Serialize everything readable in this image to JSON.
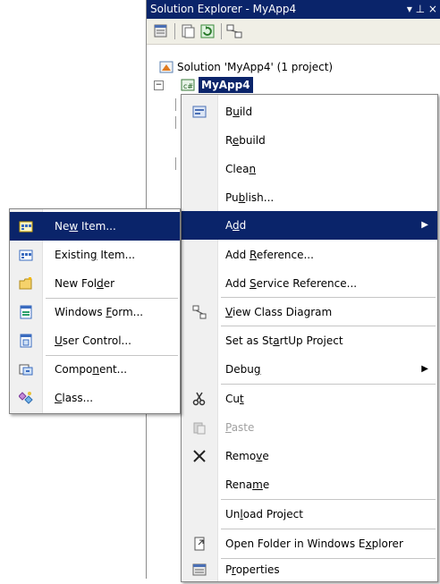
{
  "panel": {
    "title": "Solution Explorer - MyApp4",
    "title_buttons": "▾ ⊥ ×"
  },
  "tree": {
    "solution": "Solution 'MyApp4' (1 project)",
    "project": "MyApp4"
  },
  "context_menu": {
    "items": [
      {
        "pre": "B",
        "u": "u",
        "post": "ild"
      },
      {
        "pre": "R",
        "u": "e",
        "post": "build"
      },
      {
        "pre": "Clea",
        "u": "n",
        "post": ""
      },
      {
        "pre": "Pu",
        "u": "b",
        "post": "lish..."
      },
      {
        "pre": "A",
        "u": "d",
        "post": "d"
      },
      {
        "pre": "Add ",
        "u": "R",
        "post": "eference..."
      },
      {
        "pre": "Add ",
        "u": "S",
        "post": "ervice Reference..."
      },
      {
        "pre": "",
        "u": "V",
        "post": "iew Class Diagram"
      },
      {
        "pre": "Set as St",
        "u": "a",
        "post": "rtUp Project"
      },
      {
        "pre": "Debu",
        "u": "g",
        "post": ""
      },
      {
        "pre": "Cu",
        "u": "t",
        "post": ""
      },
      {
        "pre": "",
        "u": "P",
        "post": "aste"
      },
      {
        "pre": "Remo",
        "u": "v",
        "post": "e"
      },
      {
        "pre": "Rena",
        "u": "m",
        "post": "e"
      },
      {
        "pre": "Un",
        "u": "l",
        "post": "oad Project"
      },
      {
        "pre": "Open Folder in Windows E",
        "u": "x",
        "post": "plorer"
      },
      {
        "pre": "P",
        "u": "r",
        "post": "operties"
      }
    ]
  },
  "add_submenu": {
    "items": [
      {
        "pre": "Ne",
        "u": "w",
        "post": " Item..."
      },
      {
        "pre": "Existin",
        "u": "g",
        "post": " Item..."
      },
      {
        "pre": "New Fol",
        "u": "d",
        "post": "er"
      },
      {
        "pre": "Windows ",
        "u": "F",
        "post": "orm..."
      },
      {
        "pre": "",
        "u": "U",
        "post": "ser Control..."
      },
      {
        "pre": "Compo",
        "u": "n",
        "post": "ent..."
      },
      {
        "pre": "",
        "u": "C",
        "post": "lass..."
      }
    ]
  },
  "colors": {
    "highlight": "#0a246a",
    "title_bar": "#0a246a"
  }
}
